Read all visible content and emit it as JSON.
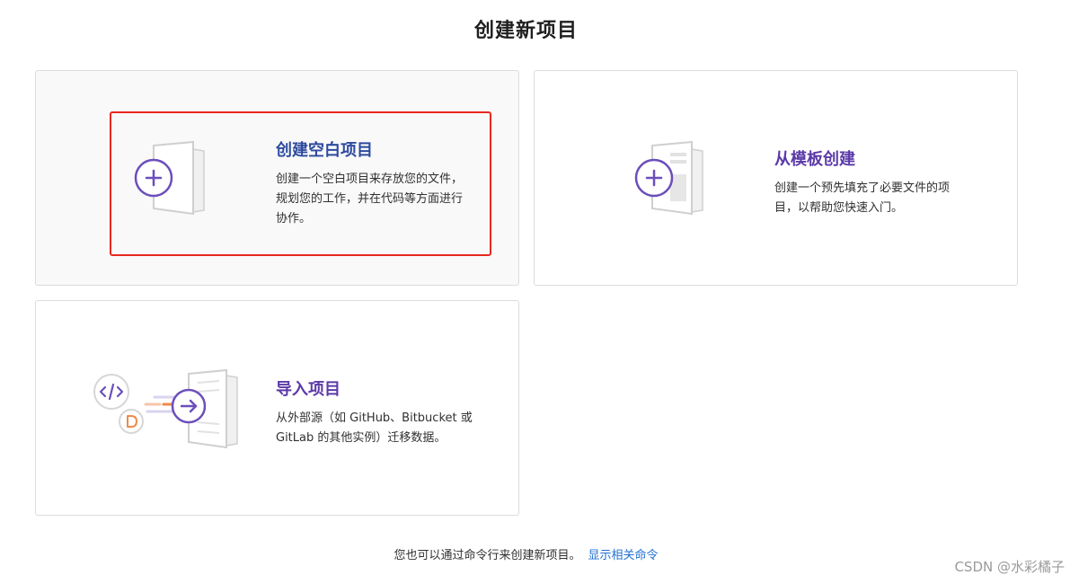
{
  "header": {
    "title": "创建新项目"
  },
  "cards": {
    "blank": {
      "heading": "创建空白项目",
      "desc_line1": "创建一个空白项目来存放您的文件，",
      "desc_line2": "规划您的工作，并在代码等方面进行",
      "desc_line3": "协作。",
      "icon": "plus-circle-icon"
    },
    "template": {
      "heading": "从模板创建",
      "desc_line1": "创建一个预先填充了必要文件的项",
      "desc_line2": "目，以帮助您快速入门。",
      "icon": "plus-circle-icon"
    },
    "import": {
      "heading": "导入项目",
      "desc_line1": "从外部源（如 GitHub、Bitbucket 或",
      "desc_line2": "GitLab 的其他实例）迁移数据。",
      "icon": "arrow-right-circle-icon"
    }
  },
  "footer": {
    "text": "您也可以通过命令行来创建新项目。",
    "link": "显示相关命令"
  },
  "watermark": {
    "text": "CSDN @水彩橘子"
  },
  "colors": {
    "accent_purple": "#6b4fbb",
    "heading_blue": "#2d4a9e",
    "link_blue": "#1f6fd1",
    "highlight_red": "#e8281f"
  }
}
